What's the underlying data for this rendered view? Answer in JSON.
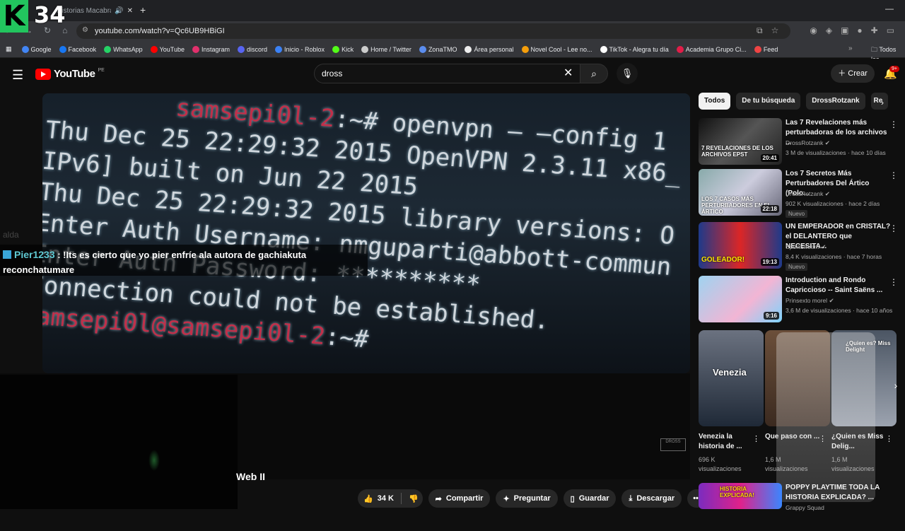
{
  "browser": {
    "tab_title": "Historias Macabras Y",
    "url": "youtube.com/watch?v=Qc6UB9HBiGI",
    "overlay_logo": "K",
    "overlay_number": "34",
    "bookmarks": [
      "Google",
      "Facebook",
      "WhatsApp",
      "YouTube",
      "Instagram",
      "discord",
      "Inicio - Roblox",
      "Kick",
      "Home / Twitter",
      "ZonaTMO",
      "Área personal",
      "Novel Cool - Lee no...",
      "TikTok - Alegra tu día",
      "Academia Grupo Ci...",
      "Feed"
    ],
    "bookmark_colors": [
      "#4285f4",
      "#1877f2",
      "#25d366",
      "#ff0000",
      "#e1306c",
      "#5865f2",
      "#3b82f6",
      "#53fc18",
      "#cccccc",
      "#5b8def",
      "#eeeeee",
      "#f59e0b",
      "#ffffff",
      "#e11d48",
      "#ef4444"
    ],
    "bookmarks_folder": "Todos los"
  },
  "youtube": {
    "logo_text": "YouTube",
    "country": "PE",
    "search_value": "dross",
    "create_label": "Crear",
    "notif_badge": "9+"
  },
  "video": {
    "terminal_lines": [
      {
        "pre": "samsepi0l-2",
        "suf": ":~# openvpn — —config 1"
      },
      {
        "pre": "",
        "suf": "Thu Dec 25 22:29:32 2015 OpenVPN 2.3.11 x86_"
      },
      {
        "pre": "",
        "suf": "IPv6] built on Jun 22 2015"
      },
      {
        "pre": "",
        "suf": "Thu Dec 25 22:29:32 2015 library versions: O"
      },
      {
        "pre": "",
        "suf": "Enter Auth Username: nmguparti@abbott-commun"
      },
      {
        "pre": "",
        "suf": "Enter Auth Password: **********"
      },
      {
        "pre": "",
        "suf": "Connection could not be established."
      },
      {
        "pre": "samsepi0l@samsepi0l-2",
        "suf": ":~#"
      }
    ],
    "bottom_text": "Web II"
  },
  "chat": {
    "faded_user": "alda",
    "user": "Pier1233",
    "message": ": !Its es cierto que yo pier enfríe ala autora de gachiakuta reconchatumare"
  },
  "actions": {
    "likes": "34 K",
    "share": "Compartir",
    "ask": "Preguntar",
    "save": "Guardar",
    "download": "Descargar"
  },
  "chips": [
    "Todos",
    "De tu búsqueda",
    "DrossRotzank",
    "Re"
  ],
  "recommendations": [
    {
      "title": "Las 7 Revelaciones más perturbadoras de los archivos ...",
      "channel": "DrossRotzank",
      "meta": "3 M de visualizaciones · hace 10 días",
      "duration": "20:41",
      "badge": "",
      "thumb_text": "7 REVELACIONES DE LOS ARCHIVOS EPST"
    },
    {
      "title": "Los 7 Secretos Más Perturbadores Del Ártico (Polo...",
      "channel": "DrossRotzank",
      "meta": "902 K visualizaciones · hace 2 días",
      "duration": "22:18",
      "badge": "Nuevo",
      "thumb_text": "LOS 7 CASOS MÁS PERTURBADORES EN EL ÁRTICO"
    },
    {
      "title": "UN EMPERADOR en CRISTAL? el DELANTERO que NECESITA...",
      "channel": "SportStream",
      "meta": "8,4 K visualizaciones · hace 7 horas",
      "duration": "19:13",
      "badge": "Nuevo",
      "thumb_text": "GOLEADOR!"
    },
    {
      "title": "Introduction and Rondo Capriccioso -- Saint Saëns ...",
      "channel": "Prinsexto morel",
      "meta": "3,6 M de visualizaciones · hace 10 años",
      "duration": "9:16",
      "badge": "",
      "thumb_text": ""
    }
  ],
  "shorts": [
    {
      "title": "Venezia la historia de ...",
      "views": "696 K visualizaciones",
      "overlay": "Venezia"
    },
    {
      "title": "Que paso con ...",
      "views": "1,6 M visualizaciones",
      "overlay": ""
    },
    {
      "title": "¿Quien es Miss Delig...",
      "views": "1,6 M visualizaciones",
      "overlay": "¿Quien es? Miss Delight"
    }
  ],
  "next_item": {
    "title": "POPPY PLAYTIME TODA LA HISTORIA EXPLICADA? ...",
    "channel": "Grappy Squad",
    "thumb_text": "HISTORIA EXPLICADA!"
  }
}
